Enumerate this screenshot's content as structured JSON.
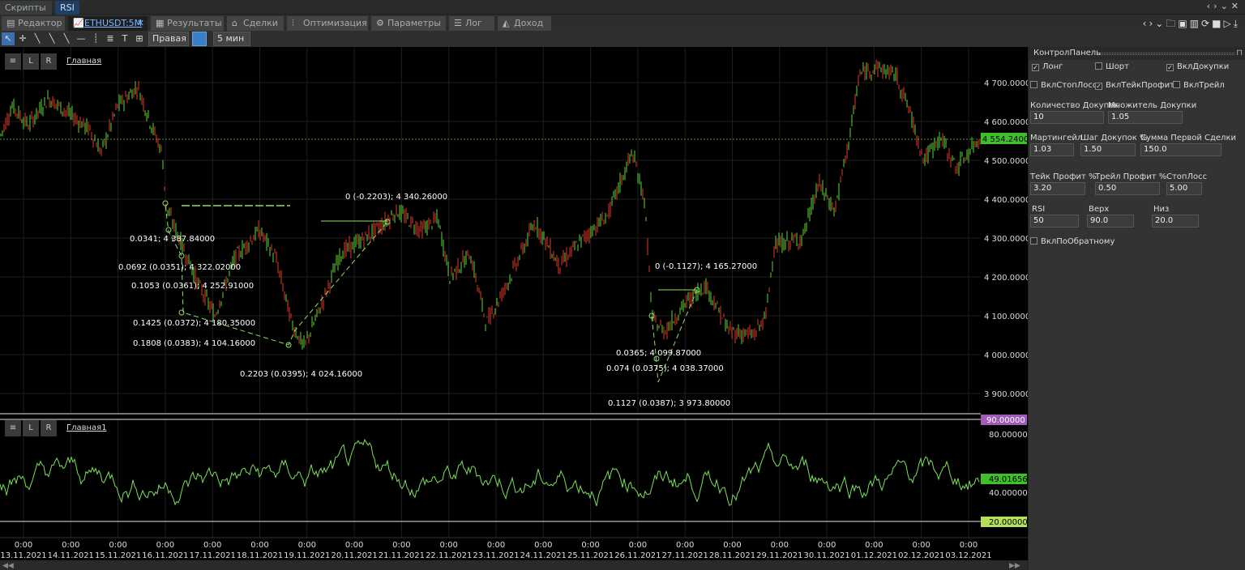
{
  "doc_tabs": [
    {
      "label": "Скрипты"
    },
    {
      "label": "RSI"
    }
  ],
  "module_tabs": [
    {
      "label": "Редактор"
    },
    {
      "label": "ETHUSDT:5M"
    },
    {
      "label": "Результаты"
    },
    {
      "label": "Сделки"
    },
    {
      "label": "Оптимизация"
    },
    {
      "label": "Параметры"
    },
    {
      "label": "Лог"
    },
    {
      "label": "Доход"
    }
  ],
  "toolbar": {
    "axis_side": "Правая",
    "timeframe": "5 мин"
  },
  "main_pane": {
    "btn_list": "≡",
    "btn_l": "L",
    "btn_r": "R",
    "title": "Главная",
    "price_ticks": [
      "4 700.00000",
      "4 600.00000",
      "4 500.00000",
      "4 400.00000",
      "4 300.00000",
      "4 200.00000",
      "4 100.00000",
      "4 000.00000",
      "3 900.00000"
    ],
    "current_price": "4 554.24000",
    "annotations": [
      "0.0341; 4 387.84000",
      "0.0692 (0.0351); 4 322.02000",
      "0.1053 (0.0361); 4 252.91000",
      "0.1425 (0.0372); 4 180.35000",
      "0.1808 (0.0383); 4 104.16000",
      "0.2203 (0.0395); 4 024.16000",
      "0 (-0.2203); 4 340.26000",
      "0 (-0.1127); 4 165.27000",
      "0.0365; 4 099.87000",
      "0.074 (0.0375); 4 038.37000",
      "0.1127 (0.0387); 3 973.80000"
    ]
  },
  "rsi_pane": {
    "btn_list": "≡",
    "btn_l": "L",
    "btn_r": "R",
    "title": "Главная1",
    "upper": "90.00000",
    "tick_80": "80.00000",
    "current": "49.01656",
    "tick_40": "40.00000",
    "lower": "20.00000"
  },
  "time_axis": [
    {
      "t": "0:00",
      "d": "13.11.2021"
    },
    {
      "t": "0:00",
      "d": "14.11.2021"
    },
    {
      "t": "0:00",
      "d": "15.11.2021"
    },
    {
      "t": "0:00",
      "d": "16.11.2021"
    },
    {
      "t": "0:00",
      "d": "17.11.2021"
    },
    {
      "t": "0:00",
      "d": "18.11.2021"
    },
    {
      "t": "0:00",
      "d": "19.11.2021"
    },
    {
      "t": "0:00",
      "d": "20.11.2021"
    },
    {
      "t": "0:00",
      "d": "21.11.2021"
    },
    {
      "t": "0:00",
      "d": "22.11.2021"
    },
    {
      "t": "0:00",
      "d": "23.11.2021"
    },
    {
      "t": "0:00",
      "d": "24.11.2021"
    },
    {
      "t": "0:00",
      "d": "25.11.2021"
    },
    {
      "t": "0:00",
      "d": "26.11.2021"
    },
    {
      "t": "0:00",
      "d": "27.11.2021"
    },
    {
      "t": "0:00",
      "d": "28.11.2021"
    },
    {
      "t": "0:00",
      "d": "29.11.2021"
    },
    {
      "t": "0:00",
      "d": "30.11.2021"
    },
    {
      "t": "0:00",
      "d": "01.12.2021"
    },
    {
      "t": "0:00",
      "d": "02.12.2021"
    },
    {
      "t": "0:00",
      "d": "03.12.2021"
    }
  ],
  "colors": {
    "bull": "#5fd33a",
    "bear": "#e03a2a",
    "rsi": "#7be05a",
    "accent": "#3a7fc7"
  },
  "panel": {
    "title": "КонтролПанель",
    "long": "Лонг",
    "long_checked": true,
    "short": "Шорт",
    "short_checked": false,
    "add_on": "ВклДокупки",
    "add_on_checked": true,
    "stoploss_on": "ВклСтопЛосс",
    "stoploss_on_checked": false,
    "takeprofit_on": "ВклТейкПрофит",
    "takeprofit_on_checked": true,
    "trail_on": "ВклТрейл",
    "trail_on_checked": false,
    "add_count_label": "Количество Докупок",
    "add_count": "10",
    "add_mult_label": "Множитель Докупки",
    "add_mult": "1.05",
    "martingale_label": "Мартингейл",
    "martingale": "1.03",
    "add_step_label": "Шаг Докупок %",
    "add_step": "1.50",
    "first_sum_label": "Сумма Первой Сделки",
    "first_sum": "150.0",
    "tp_label": "Тейк Профит %",
    "tp": "3.20",
    "trail_label": "Трейл Профит %",
    "trail": "0.50",
    "sl_label": "СтопЛосс",
    "sl": "5.00",
    "rsi_label": "RSI",
    "rsi": "50",
    "upper_label": "Верх",
    "upper": "90.0",
    "lower_label": "Низ",
    "lower": "20.0",
    "reverse": "ВклПоОбратному",
    "reverse_checked": false
  }
}
